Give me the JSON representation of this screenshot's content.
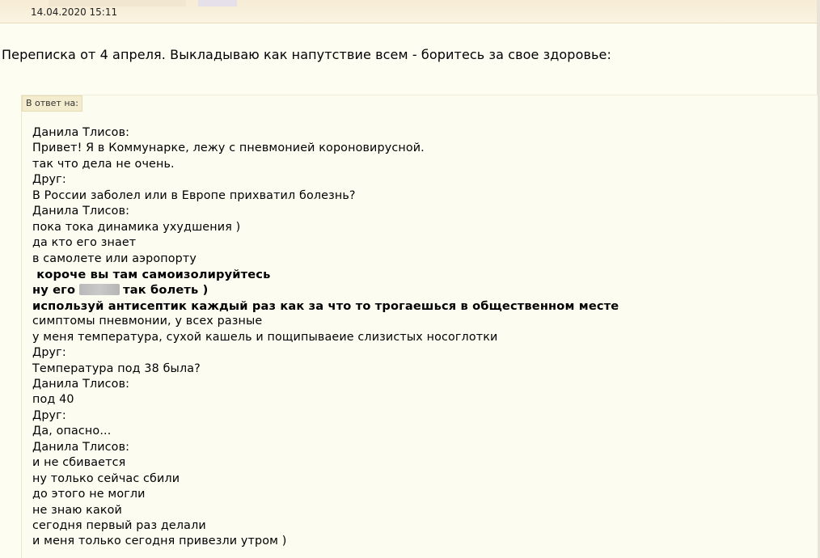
{
  "post": {
    "date": "14.04.2020 15:11",
    "intro": "Переписка от 4 апреля. Выкладываю как напутствие всем - боритесь за свое здоровье:"
  },
  "quote": {
    "label": "В ответ на:",
    "lines": [
      {
        "text": "Данила Тлисов:"
      },
      {
        "text": "Привет! Я в Коммунарке, лежу с пневмонией короновирусной."
      },
      {
        "text": "так что дела не очень."
      },
      {
        "text": "Друг:"
      },
      {
        "text": "В России заболел или в Европе прихватил болезнь?"
      },
      {
        "text": "Данила Тлисов:"
      },
      {
        "text": "пока тока динамика ухудшения )"
      },
      {
        "text": "да кто его знает"
      },
      {
        "text": "в самолете или аэропорту"
      },
      {
        "text": " короче вы там самоизолируйтесь"
      },
      {
        "text_before": "ну его",
        "text_after": "так болеть )"
      },
      {
        "text": "используй антисептик каждый раз как за что то трогаешься в общественном месте"
      },
      {
        "text": "симптомы пневмонии, у всех разные"
      },
      {
        "text": "у меня температура, сухой кашель и пощипываеие слизистых носоглотки"
      },
      {
        "text": "Друг:"
      },
      {
        "text": "Температура под 38 была?"
      },
      {
        "text": "Данила Тлисов:"
      },
      {
        "text": "под 40"
      },
      {
        "text": "Друг:"
      },
      {
        "text": "Да, опасно..."
      },
      {
        "text": "Данила Тлисов:"
      },
      {
        "text": "и не сбивается"
      },
      {
        "text": "ну только сейчас сбили"
      },
      {
        "text": "до этого не могли"
      },
      {
        "text": "не знаю какой"
      },
      {
        "text": "сегодня первый раз делали"
      },
      {
        "text": "и меня только сегодня привезли утром )"
      }
    ]
  }
}
